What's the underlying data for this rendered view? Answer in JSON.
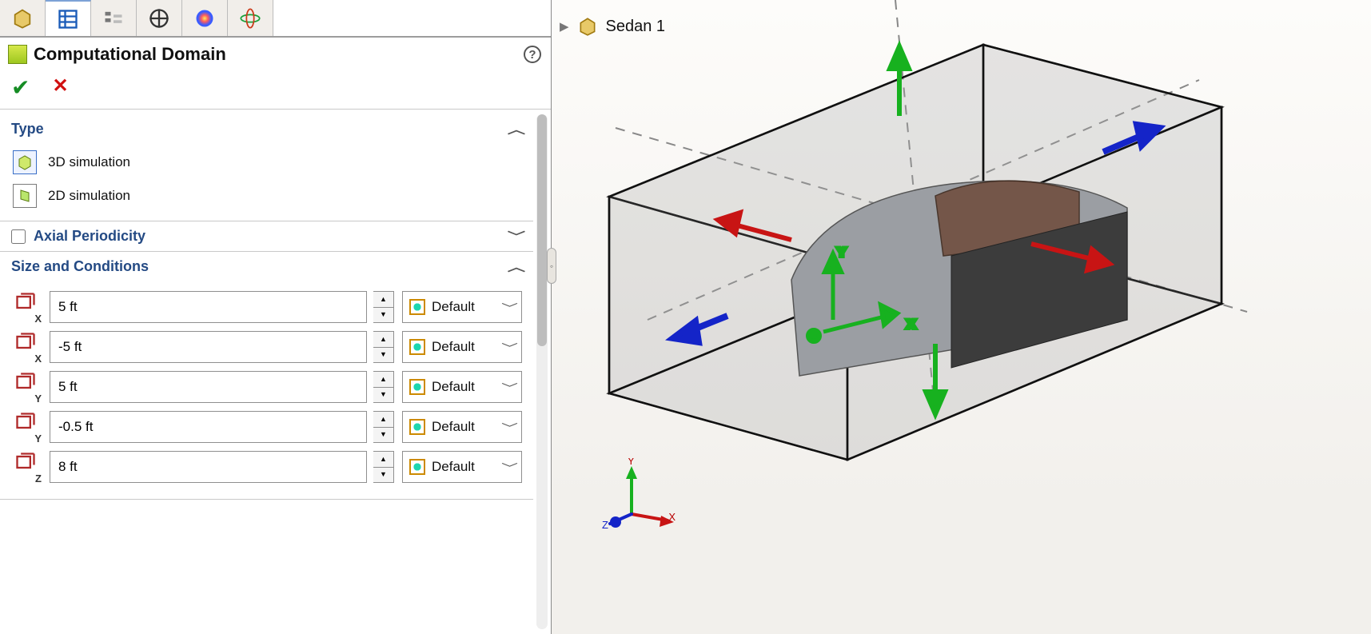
{
  "panel": {
    "title": "Computational Domain",
    "type_label": "Type",
    "options": {
      "sim3d": "3D simulation",
      "sim2d": "2D simulation"
    },
    "axial_periodicity_label": "Axial Periodicity",
    "axial_periodicity_checked": false,
    "size_label": "Size and Conditions",
    "rows": [
      {
        "axis": "X",
        "sign": "max",
        "value": "5 ft",
        "dropdown": "Default"
      },
      {
        "axis": "X",
        "sign": "min",
        "value": "-5 ft",
        "dropdown": "Default"
      },
      {
        "axis": "Y",
        "sign": "max",
        "value": "5 ft",
        "dropdown": "Default"
      },
      {
        "axis": "Y",
        "sign": "min",
        "value": "-0.5 ft",
        "dropdown": "Default"
      },
      {
        "axis": "Z",
        "sign": "max",
        "value": "8 ft",
        "dropdown": "Default"
      }
    ]
  },
  "viewport": {
    "model_name": "Sedan 1",
    "triad": {
      "x": "X",
      "y": "Y",
      "z": "Z"
    }
  }
}
